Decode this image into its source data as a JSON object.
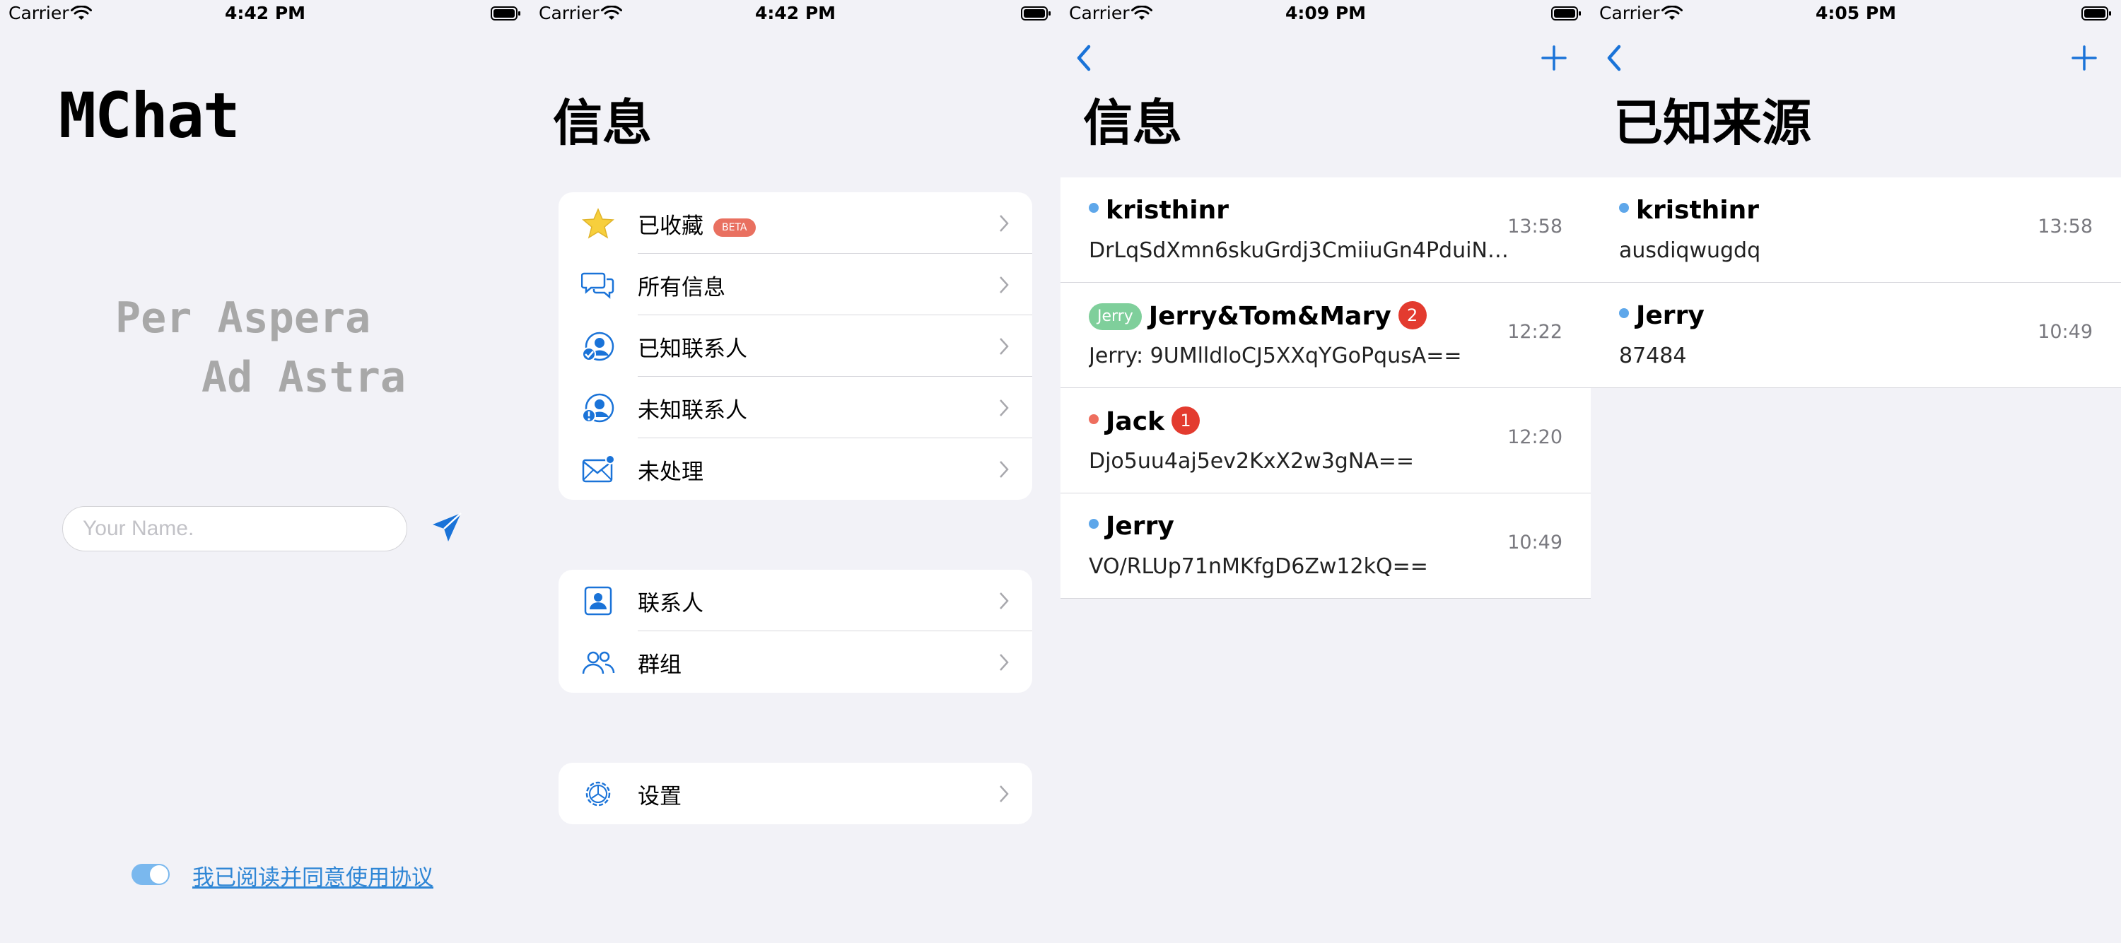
{
  "colors": {
    "background": "#f2f2f7",
    "accent": "#1a73d8",
    "link": "#2f86d5",
    "badge": "#e33b2f",
    "online_dot": "#5ea7ea",
    "offline_dot": "#ee6e5e",
    "group_tag": "#7fcf9b",
    "beta_tag": "#e97060"
  },
  "screens": [
    {
      "status": {
        "carrier": "Carrier",
        "time": "4:42 PM"
      },
      "logo": "MChat",
      "motto": {
        "line1": "Per Aspera",
        "line2": "Ad Astra"
      },
      "name_input": {
        "placeholder": "Your Name.",
        "value": ""
      },
      "send_icon": "paper-plane-icon",
      "agree": {
        "toggle_on": true,
        "link_text": "我已阅读并同意使用协议"
      }
    },
    {
      "status": {
        "carrier": "Carrier",
        "time": "4:42 PM"
      },
      "title": "信息",
      "groups": [
        [
          {
            "icon": "star-icon",
            "label": "已收藏",
            "tag": "BETA"
          },
          {
            "icon": "chat-bubbles-icon",
            "label": "所有信息"
          },
          {
            "icon": "known-contacts-icon",
            "label": "已知联系人"
          },
          {
            "icon": "unknown-contacts-icon",
            "label": "未知联系人"
          },
          {
            "icon": "envelope-badge-icon",
            "label": "未处理"
          }
        ],
        [
          {
            "icon": "contact-card-icon",
            "label": "联系人"
          },
          {
            "icon": "group-icon",
            "label": "群组"
          }
        ],
        [
          {
            "icon": "settings-gear-icon",
            "label": "设置"
          }
        ]
      ]
    },
    {
      "status": {
        "carrier": "Carrier",
        "time": "4:09 PM"
      },
      "title": "信息",
      "messages": [
        {
          "name": "kristhinr",
          "dot": "blue",
          "preview": "DrLqSdXmn6skuGrdj3CmiiuGn4PduiN+...",
          "time": "13:58"
        },
        {
          "tag": "Jerry",
          "name": "Jerry&Tom&Mary",
          "badge": "2",
          "preview": "Jerry: 9UMlldloCJ5XXqYGoPqusA==",
          "time": "12:22"
        },
        {
          "name": "Jack",
          "dot": "red",
          "badge": "1",
          "preview": "Djo5uu4aj5ev2KxX2w3gNA==",
          "time": "12:20"
        },
        {
          "name": "Jerry",
          "dot": "blue",
          "preview": "VO/RLUp71nMKfgD6Zw12kQ==",
          "time": "10:49"
        }
      ]
    },
    {
      "status": {
        "carrier": "Carrier",
        "time": "4:05 PM"
      },
      "title": "已知来源",
      "messages": [
        {
          "name": "kristhinr",
          "dot": "blue",
          "preview": "ausdiqwugdq",
          "time": "13:58"
        },
        {
          "name": "Jerry",
          "dot": "blue",
          "preview": "87484",
          "time": "10:49"
        }
      ]
    }
  ]
}
